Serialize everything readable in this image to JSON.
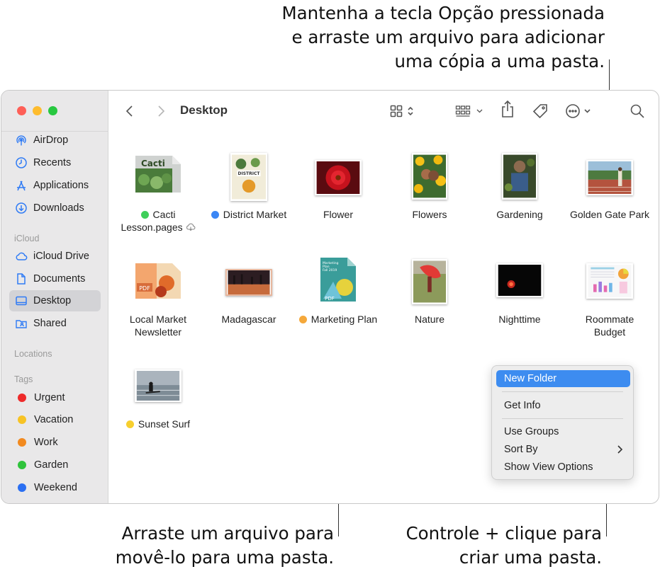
{
  "callouts": {
    "top": "Mantenha a tecla Opção pressionada\ne arraste um arquivo para adicionar\numa cópia a uma pasta.",
    "bottom_left": "Arraste um arquivo para\nmovê-lo para uma pasta.",
    "bottom_right": "Controle + clique para\ncriar uma pasta."
  },
  "toolbar": {
    "title": "Desktop"
  },
  "sidebar": {
    "favorites": [
      {
        "label": "AirDrop",
        "icon": "airdrop-icon"
      },
      {
        "label": "Recents",
        "icon": "clock-icon"
      },
      {
        "label": "Applications",
        "icon": "applications-icon"
      },
      {
        "label": "Downloads",
        "icon": "download-icon"
      }
    ],
    "icloud_header": "iCloud",
    "icloud": [
      {
        "label": "iCloud Drive",
        "icon": "cloud-icon"
      },
      {
        "label": "Documents",
        "icon": "document-icon"
      },
      {
        "label": "Desktop",
        "icon": "desktop-icon",
        "selected": true
      },
      {
        "label": "Shared",
        "icon": "shared-folder-icon"
      }
    ],
    "locations_header": "Locations",
    "tags_header": "Tags",
    "tags": [
      {
        "label": "Urgent",
        "color": "#ee2a2a"
      },
      {
        "label": "Vacation",
        "color": "#f7c325"
      },
      {
        "label": "Work",
        "color": "#f28a1f"
      },
      {
        "label": "Garden",
        "color": "#2fc33b"
      },
      {
        "label": "Weekend",
        "color": "#2b6ff2"
      }
    ]
  },
  "files": [
    {
      "line1": "Cacti",
      "line2": "Lesson.pages",
      "tag": "#3fcf5a",
      "cloud": true
    },
    {
      "line1": "District Market",
      "line2": "",
      "tag": "#3a86f5"
    },
    {
      "line1": "Flower",
      "line2": ""
    },
    {
      "line1": "Flowers",
      "line2": ""
    },
    {
      "line1": "Gardening",
      "line2": ""
    },
    {
      "line1": "Golden Gate Park",
      "line2": ""
    },
    {
      "line1": "Local Market",
      "line2": "Newsletter"
    },
    {
      "line1": "Madagascar",
      "line2": ""
    },
    {
      "line1": "Marketing Plan",
      "line2": "",
      "tag": "#f5a83a"
    },
    {
      "line1": "Nature",
      "line2": ""
    },
    {
      "line1": "Nighttime",
      "line2": ""
    },
    {
      "line1": "Roommate",
      "line2": "Budget"
    },
    {
      "line1": "Sunset Surf",
      "line2": "",
      "tag": "#f7cf2e"
    }
  ],
  "thumb_text": {
    "cacti": "Cacti",
    "district": "DISTRICT",
    "pdf": "PDF",
    "marketing": "Marketing\nPlan\nFall 2019"
  },
  "menu": {
    "items": [
      "New Folder",
      "Get Info",
      "Use Groups",
      "Sort By",
      "Show View Options"
    ]
  }
}
